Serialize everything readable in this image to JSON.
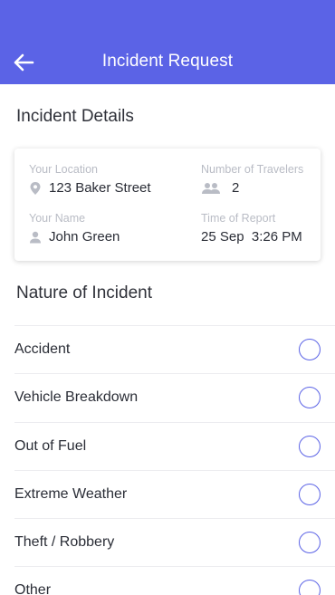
{
  "header": {
    "title": "Incident Request"
  },
  "details": {
    "section_title": "Incident Details",
    "location_label": "Your Location",
    "location_value": "123 Baker Street",
    "travelers_label": "Number of Travelers",
    "travelers_value": "2",
    "name_label": "Your Name",
    "name_value": "John Green",
    "time_label": "Time of Report",
    "time_value": "25 Sep  3:26 PM"
  },
  "nature": {
    "section_title": "Nature of Incident",
    "options": [
      {
        "label": "Accident"
      },
      {
        "label": "Vehicle Breakdown"
      },
      {
        "label": "Out of Fuel"
      },
      {
        "label": "Extreme Weather"
      },
      {
        "label": "Theft / Robbery"
      },
      {
        "label": "Other"
      }
    ]
  },
  "colors": {
    "accent": "#5b63e6",
    "label_gray": "#b9bcc5",
    "text_dark": "#2a2d36"
  },
  "icons": {
    "back": "arrow-left-icon",
    "location": "location-pin-icon",
    "travelers": "people-icon",
    "name": "person-icon"
  }
}
